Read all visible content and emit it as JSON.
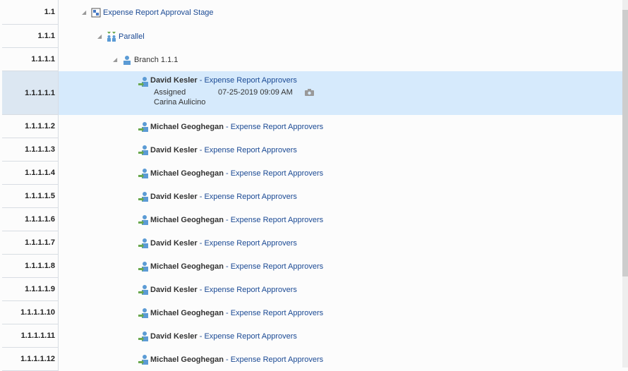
{
  "tree": {
    "stage": {
      "num": "1.1",
      "label": "Expense Report Approval Stage"
    },
    "parallel": {
      "num": "1.1.1",
      "label": "Parallel"
    },
    "branch": {
      "num": "1.1.1.1",
      "label": "Branch 1.1.1"
    },
    "selected": {
      "num": "1.1.1.1.1",
      "name": "David Kesler",
      "sep": " - ",
      "group": "Expense Report Approvers",
      "status": "Assigned",
      "date": "07-25-2019 09:09 AM",
      "assignee": "Carina Aulicino"
    },
    "rows": [
      {
        "num": "1.1.1.1.2",
        "name": "Michael Geoghegan",
        "sep": " - ",
        "group": "Expense Report Approvers"
      },
      {
        "num": "1.1.1.1.3",
        "name": "David Kesler",
        "sep": " - ",
        "group": "Expense Report Approvers"
      },
      {
        "num": "1.1.1.1.4",
        "name": "Michael Geoghegan",
        "sep": " - ",
        "group": "Expense Report Approvers"
      },
      {
        "num": "1.1.1.1.5",
        "name": "David Kesler",
        "sep": " - ",
        "group": "Expense Report Approvers"
      },
      {
        "num": "1.1.1.1.6",
        "name": "Michael Geoghegan",
        "sep": " - ",
        "group": "Expense Report Approvers"
      },
      {
        "num": "1.1.1.1.7",
        "name": "David Kesler",
        "sep": " - ",
        "group": "Expense Report Approvers"
      },
      {
        "num": "1.1.1.1.8",
        "name": "Michael Geoghegan",
        "sep": " - ",
        "group": "Expense Report Approvers"
      },
      {
        "num": "1.1.1.1.9",
        "name": "David Kesler",
        "sep": " - ",
        "group": "Expense Report Approvers"
      },
      {
        "num": "1.1.1.1.10",
        "name": "Michael Geoghegan",
        "sep": " - ",
        "group": "Expense Report Approvers"
      },
      {
        "num": "1.1.1.1.11",
        "name": "David Kesler",
        "sep": " - ",
        "group": "Expense Report Approvers"
      },
      {
        "num": "1.1.1.1.12",
        "name": "Michael Geoghegan",
        "sep": " - ",
        "group": "Expense Report Approvers"
      }
    ]
  }
}
